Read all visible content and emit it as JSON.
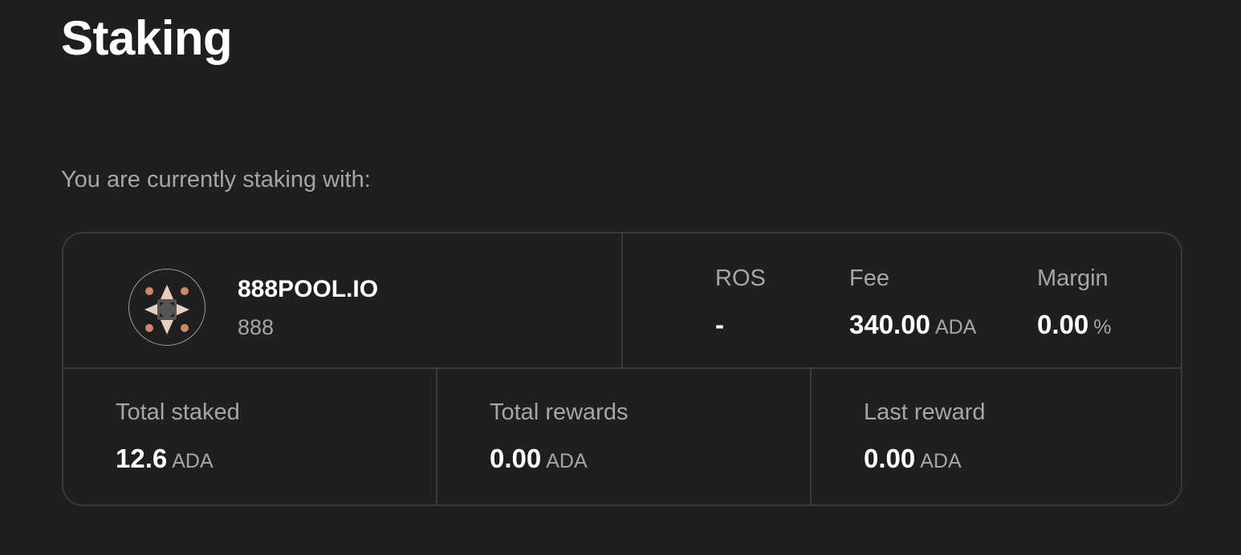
{
  "page": {
    "title": "Staking",
    "subtitle": "You are currently staking with:"
  },
  "pool": {
    "name": "888POOL.IO",
    "ticker": "888",
    "logo_icon": "pool-logo-icon"
  },
  "pool_stats": {
    "ros": {
      "label": "ROS",
      "value": "-"
    },
    "fee": {
      "label": "Fee",
      "value": "340.00",
      "unit": "ADA"
    },
    "margin": {
      "label": "Margin",
      "value": "0.00",
      "unit": "%"
    }
  },
  "summary": {
    "total_staked": {
      "label": "Total staked",
      "value": "12.6",
      "unit": "ADA"
    },
    "total_rewards": {
      "label": "Total rewards",
      "value": "0.00",
      "unit": "ADA"
    },
    "last_reward": {
      "label": "Last reward",
      "value": "0.00",
      "unit": "ADA"
    }
  },
  "colors": {
    "background": "#1f1f1f",
    "border": "#3a3a3a",
    "text_primary": "#ffffff",
    "text_secondary": "#a6a6a6",
    "logo_accent": "#c98a6b",
    "logo_light": "#e9cfc0"
  }
}
